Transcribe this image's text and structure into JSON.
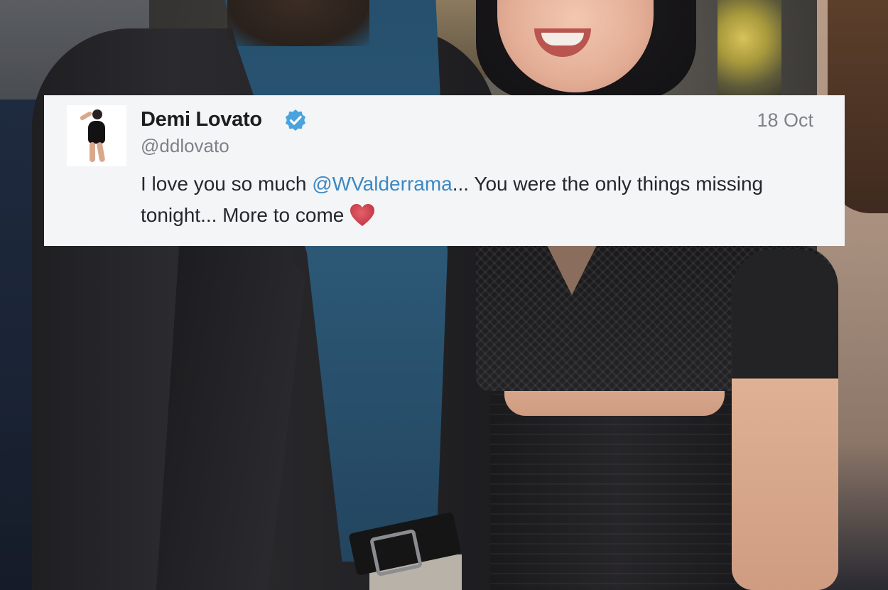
{
  "tweet": {
    "display_name": "Demi Lovato",
    "handle": "@ddlovato",
    "date": "18 Oct",
    "text_before": "I love you so much ",
    "mention": "@WValderrama",
    "text_after": "... You were the only things missing tonight... More to come",
    "verified": true
  },
  "icons": {
    "verified": "verified-badge-icon",
    "heart": "heart-icon"
  },
  "colors": {
    "mention": "#3b88c3",
    "verified": "#4aa3df",
    "heart": "#d2454e",
    "card_background": "#f4f5f6"
  }
}
